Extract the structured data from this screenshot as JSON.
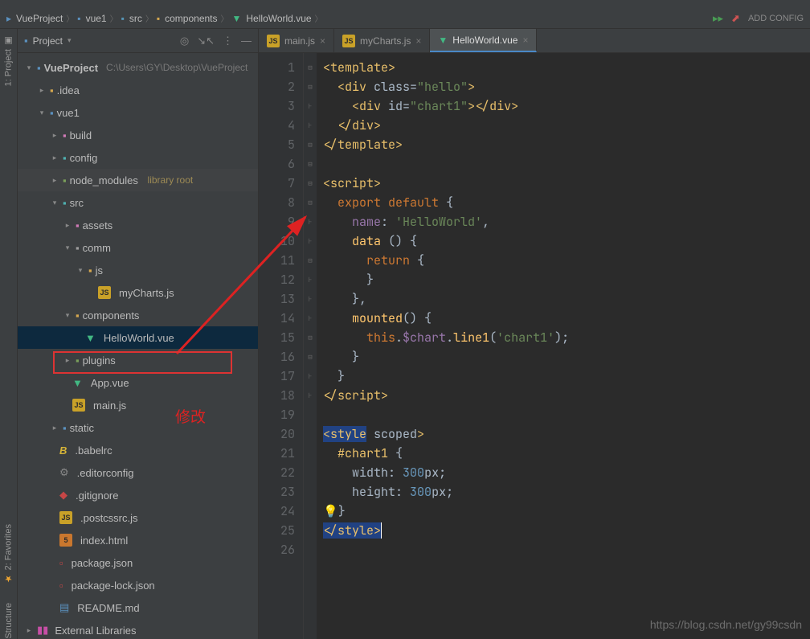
{
  "breadcrumbs": {
    "items": [
      {
        "icon": "project-icon",
        "label": "VueProject"
      },
      {
        "icon": "folder-icon",
        "label": "vue1"
      },
      {
        "icon": "folder-icon",
        "label": "src"
      },
      {
        "icon": "folder-icon",
        "label": "components"
      },
      {
        "icon": "vue-icon",
        "label": "HelloWorld.vue"
      }
    ],
    "add_config": "ADD CONFIG"
  },
  "left_tabs": {
    "project": "1: Project",
    "favorites": "2: Favorites",
    "structure": "Structure"
  },
  "sidebar": {
    "title": "Project",
    "root": {
      "name": "VueProject",
      "path": "C:\\Users\\GY\\Desktop\\VueProject"
    },
    "items": {
      "idea": ".idea",
      "vue1": "vue1",
      "build": "build",
      "config": "config",
      "node_modules": "node_modules",
      "lib_root": "library root",
      "src": "src",
      "assets": "assets",
      "comm": "comm",
      "js": "js",
      "mycharts": "myCharts.js",
      "components": "components",
      "helloworld": "HelloWorld.vue",
      "plugins": "plugins",
      "appvue": "App.vue",
      "mainjs": "main.js",
      "static": "static",
      "babelrc": ".babelrc",
      "editorconfig": ".editorconfig",
      "gitignore": ".gitignore",
      "postcss": ".postcssrc.js",
      "indexhtml": "index.html",
      "package": "package.json",
      "packagelock": "package-lock.json",
      "readme": "README.md",
      "extlib": "External Libraries"
    }
  },
  "tabs": {
    "t1": "main.js",
    "t2": "myCharts.js",
    "t3": "HelloWorld.vue"
  },
  "editor": {
    "lines": [
      "1",
      "2",
      "3",
      "4",
      "5",
      "6",
      "7",
      "8",
      "9",
      "10",
      "11",
      "12",
      "13",
      "14",
      "15",
      "16",
      "17",
      "18",
      "19",
      "20",
      "21",
      "22",
      "23",
      "24",
      "25",
      "26"
    ]
  },
  "annotation": {
    "modify": "修改"
  },
  "watermark": "https://blog.csdn.net/gy99csdn"
}
